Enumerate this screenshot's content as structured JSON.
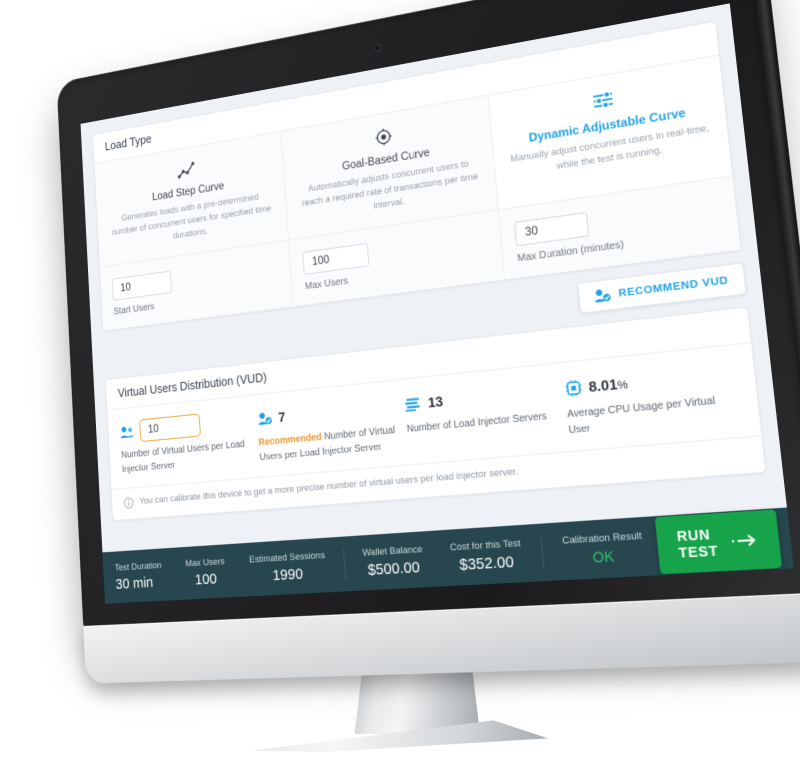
{
  "load_type": {
    "section_title": "Load Type",
    "options": [
      {
        "name": "Load Step Curve",
        "description": "Generates loads with a pre-determined number of concurrent users for specified time durations.",
        "icon": "line-chart-step-icon",
        "selected": false
      },
      {
        "name": "Goal-Based Curve",
        "description": "Automatically adjusts concurrent users to reach a required rate of transactions per time interval.",
        "icon": "target-icon",
        "selected": false
      },
      {
        "name": "Dynamic Adjustable Curve",
        "description": "Manually adjust concurrent users in real-time, while the test is running.",
        "icon": "sliders-icon",
        "selected": true
      }
    ],
    "params": [
      {
        "value": "10",
        "label": "Start Users"
      },
      {
        "value": "100",
        "label": "Max Users"
      },
      {
        "value": "30",
        "label": "Max Duration (minutes)"
      }
    ]
  },
  "recommend": {
    "label": "RECOMMEND VUD",
    "icon": "user-check-icon",
    "color": "#1ea2e8"
  },
  "vud": {
    "section_title": "Virtual Users Distribution (VUD)",
    "input_value": "10",
    "input_label": "Number of Virtual Users per Load Injector Server",
    "input_border_color": "#f0a333",
    "stats": [
      {
        "value": "7",
        "label_highlight": "Recommended",
        "label_rest": " Number of Virtual Users per Load Injector Server",
        "icon": "user-check-icon"
      },
      {
        "value": "13",
        "label_highlight": "",
        "label_rest": "Number of Load Injector Servers",
        "icon": "servers-icon"
      },
      {
        "value": "8.01",
        "unit": "%",
        "label_highlight": "",
        "label_rest": "Average CPU Usage per Virtual User",
        "icon": "cpu-icon"
      }
    ],
    "note": "You can calibrate this device to get a more precise number of virtual users per load injector server.",
    "note_icon": "info-icon"
  },
  "footer": {
    "stats": [
      {
        "key": "Test Duration",
        "value": "30 min"
      },
      {
        "key": "Max Users",
        "value": "100"
      },
      {
        "key": "Estimated Sessions",
        "value": "1990"
      },
      {
        "key": "Wallet Balance",
        "value": "$500.00"
      },
      {
        "key": "Cost for this Test",
        "value": "$352.00"
      },
      {
        "key": "Calibration Result",
        "value": "OK",
        "status": "ok"
      }
    ],
    "run_button": {
      "label": "RUN TEST",
      "icon": "arrow-right-icon",
      "color": "#16a34a"
    },
    "background": "#27464e"
  }
}
